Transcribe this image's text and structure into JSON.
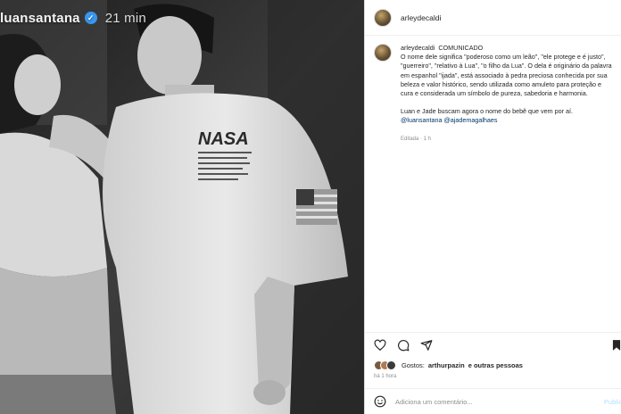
{
  "story": {
    "username": "luansantana",
    "verified_glyph": "✓",
    "time": "21 min"
  },
  "post": {
    "author": "arleydecaldi",
    "caption_title": "COMUNICADO",
    "caption_paragraphs": [
      "O nome dele significa \"poderoso como um leão\", \"ele protege e é justo\", \"guerreiro\", \"relativo à Lua\", \"o filho da Lua\". O dela é originário da palavra em espanhol \"ijada\", está associado à pedra preciosa conhecida por sua beleza e valor histórico, sendo utilizada como amuleto para proteção e cura e considerada um símbolo de pureza, sabedoria e harmonia.",
      "Luan e Jade buscam agora o nome do bebê que vem por aí."
    ],
    "mentions": [
      "@luansantana",
      "@ajademagalhaes"
    ],
    "edited": "Editada · 1 h",
    "likes_prefix": "Gostos:",
    "likes_user": "arthurpazin",
    "likes_suffix": "e outras pessoas",
    "post_time": "há 1 hora",
    "comment_placeholder": "Adiciona um comentário...",
    "publish_label": "Publicar"
  },
  "colors": {
    "verified": "#3897f0",
    "mention": "#00376b",
    "muted": "#8e8e8e"
  },
  "icons": [
    "verified-badge-icon",
    "heart-icon",
    "comment-icon",
    "share-icon",
    "bookmark-icon",
    "emoji-icon"
  ]
}
